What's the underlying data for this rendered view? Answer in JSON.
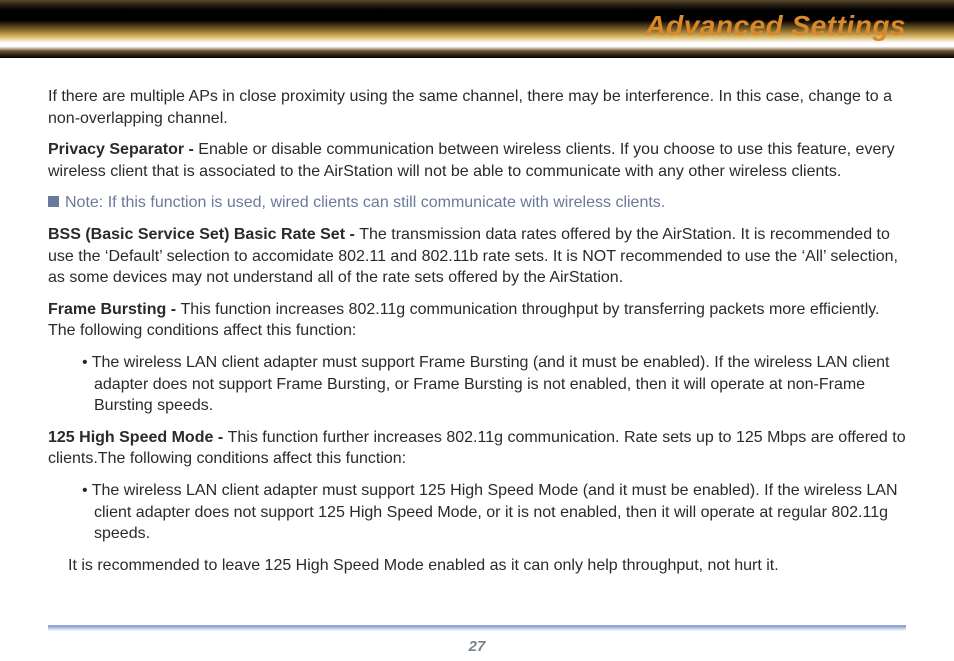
{
  "header": {
    "title": "Advanced Settings"
  },
  "body": {
    "intro": "If there are multiple APs in close proximity using the same channel, there may be interference.  In this case, change to a non-overlapping channel.",
    "privacy_label": "Privacy Separator - ",
    "privacy_text": "Enable or disable communication between wireless clients.  If you choose to use this feature, every wireless client that is associated to the AirStation will not be able to communicate with any other wireless clients.",
    "note": "Note: If this function is used, wired clients can still communicate with wireless clients.",
    "bss_label": "BSS (Basic Service Set) Basic Rate Set - ",
    "bss_text": "The transmission data rates offered by the AirStation.  It is recommended to use the ‘Default’ selection to accomidate 802.11 and 802.11b rate sets.  It is NOT recommended to use the ‘All’ selection, as some devices may not understand all of the rate sets offered by the AirStation.",
    "frame_label": "Frame Bursting - ",
    "frame_text": "This function increases 802.11g communication throughput by transferring packets more efficiently. The following conditions affect this function:",
    "frame_bullet": "• The wireless LAN client adapter must support Frame Bursting (and it must be enabled).  If the wireless LAN client adapter does not support Frame Bursting, or Frame Bursting is not enabled, then it will operate at non-Frame Bursting speeds.",
    "hs_label": "125 High Speed Mode - ",
    "hs_text": "This function further increases 802.11g communication.  Rate sets up to 125 Mbps are offered to clients.The following conditions affect this function:",
    "hs_bullet": "• The wireless LAN client adapter must support 125 High Speed Mode (and it must be enabled).  If the wireless LAN client adapter does not support 125 High Speed Mode, or it is not enabled, then it will operate at regular 802.11g speeds.",
    "hs_recommend": "It is recommended to leave 125 High Speed Mode enabled as it can only help throughput, not hurt it."
  },
  "footer": {
    "page": "27"
  }
}
